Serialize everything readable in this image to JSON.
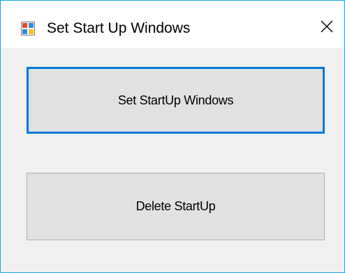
{
  "window": {
    "title": "Set Start Up Windows",
    "app_icon": "windows-form-icon",
    "close_icon": "close-icon"
  },
  "buttons": {
    "set_startup_label": "Set StartUp Windows",
    "delete_startup_label": "Delete StartUp"
  },
  "colors": {
    "window_border": "#1ba1e2",
    "focus_border": "#0078d7",
    "button_face": "#e1e1e1",
    "client_background": "#f0f0f0",
    "titlebar_background": "#ffffff"
  }
}
